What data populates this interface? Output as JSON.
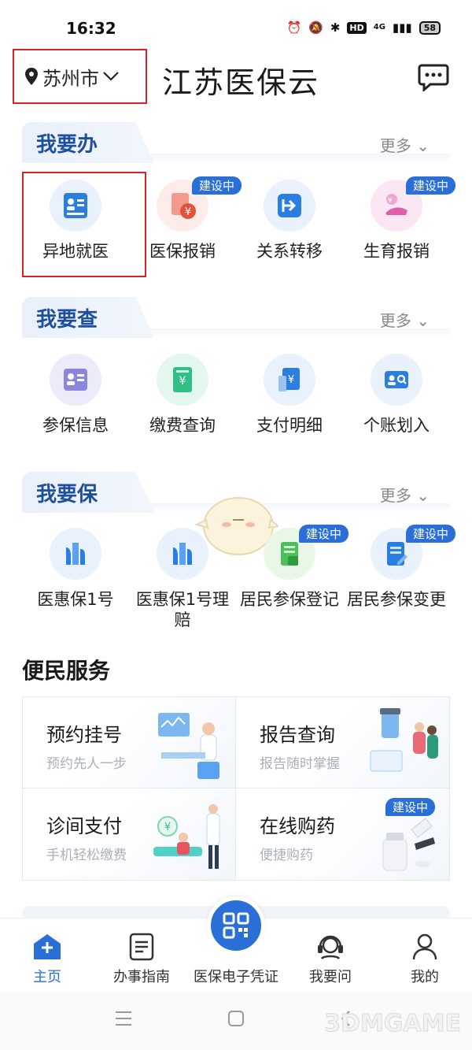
{
  "status_bar": {
    "time": "16:32",
    "hd": "HD",
    "network": "4G",
    "battery": "58"
  },
  "header": {
    "city": "苏州市",
    "title": "江苏医保云"
  },
  "sections": {
    "banli": {
      "title": "我要办",
      "more": "更多",
      "items": [
        {
          "label": "异地就医"
        },
        {
          "label": "医保报销",
          "badge": "建设中"
        },
        {
          "label": "关系转移"
        },
        {
          "label": "生育报销",
          "badge": "建设中"
        }
      ]
    },
    "cha": {
      "title": "我要查",
      "more": "更多",
      "items": [
        {
          "label": "参保信息"
        },
        {
          "label": "缴费查询"
        },
        {
          "label": "支付明细"
        },
        {
          "label": "个账划入"
        }
      ]
    },
    "bao": {
      "title": "我要保",
      "more": "更多",
      "items": [
        {
          "label": "医惠保1号"
        },
        {
          "label": "医惠保1号理赔"
        },
        {
          "label": "居民参保登记",
          "badge": "建设中"
        },
        {
          "label": "居民参保变更",
          "badge": "建设中"
        }
      ]
    }
  },
  "services": {
    "title": "便民服务",
    "cards": [
      {
        "title": "预约挂号",
        "subtitle": "预约先人一步"
      },
      {
        "title": "报告查询",
        "subtitle": "报告随时掌握"
      },
      {
        "title": "诊间支付",
        "subtitle": "手机轻松缴费"
      },
      {
        "title": "在线购药",
        "subtitle": "便捷购药",
        "badge": "建设中"
      }
    ]
  },
  "bottom_nav": {
    "items": [
      {
        "label": "主页"
      },
      {
        "label": "办事指南"
      },
      {
        "label": "医保电子凭证"
      },
      {
        "label": "我要问"
      },
      {
        "label": "我的"
      }
    ]
  },
  "watermark": "3DMGAME",
  "colors": {
    "accent": "#2a6fd8",
    "section_title": "#1e4f9c",
    "highlight": "#d32424"
  }
}
